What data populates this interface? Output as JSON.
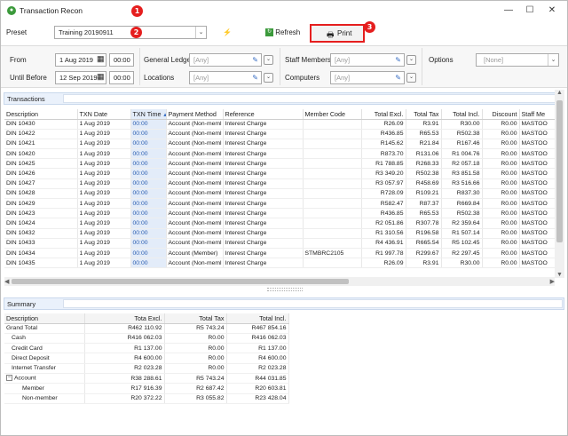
{
  "window": {
    "title": "Transaction Recon",
    "minimize": "—",
    "maximize": "☐",
    "close": "✕"
  },
  "badges": [
    "1",
    "2",
    "3"
  ],
  "toolbar": {
    "preset_label": "Preset",
    "preset_value": "Training 20190911",
    "refresh_label": "Refresh",
    "print_label": "Print"
  },
  "filters": {
    "from_label": "From",
    "from_date": "1 Aug 2019",
    "from_time": "00:00",
    "until_label": "Until Before",
    "until_date": "12 Sep 2019",
    "until_time": "00:00",
    "general_ledgers_label": "General Ledgers",
    "general_ledgers_value": "[Any]",
    "locations_label": "Locations",
    "locations_value": "[Any]",
    "staff_members_label": "Staff Members",
    "staff_members_value": "[Any]",
    "computers_label": "Computers",
    "computers_value": "[Any]",
    "options_label": "Options",
    "options_value": "[None]"
  },
  "transactions": {
    "section_label": "Transactions",
    "columns": [
      "Description",
      "TXN Date",
      "TXN Time",
      "Payment Method",
      "Reference",
      "Member Code",
      "Total Excl.",
      "Total Tax",
      "Total Incl.",
      "Discount",
      "Staff Me"
    ],
    "rows": [
      [
        "DIN 10430",
        "1 Aug 2019",
        "00:00",
        "Account (Non-meml",
        "Interest Charge",
        "",
        "R26.09",
        "R3.91",
        "R30.00",
        "R0.00",
        "MASTOO"
      ],
      [
        "DIN 10422",
        "1 Aug 2019",
        "00:00",
        "Account (Non-meml",
        "Interest Charge",
        "",
        "R436.85",
        "R65.53",
        "R502.38",
        "R0.00",
        "MASTOO"
      ],
      [
        "DIN 10421",
        "1 Aug 2019",
        "00:00",
        "Account (Non-meml",
        "Interest Charge",
        "",
        "R145.62",
        "R21.84",
        "R167.46",
        "R0.00",
        "MASTOO"
      ],
      [
        "DIN 10420",
        "1 Aug 2019",
        "00:00",
        "Account (Non-meml",
        "Interest Charge",
        "",
        "R873.70",
        "R131.06",
        "R1 004.76",
        "R0.00",
        "MASTOO"
      ],
      [
        "DIN 10425",
        "1 Aug 2019",
        "00:00",
        "Account (Non-meml",
        "Interest Charge",
        "",
        "R1 788.85",
        "R268.33",
        "R2 057.18",
        "R0.00",
        "MASTOO"
      ],
      [
        "DIN 10426",
        "1 Aug 2019",
        "00:00",
        "Account (Non-meml",
        "Interest Charge",
        "",
        "R3 349.20",
        "R502.38",
        "R3 851.58",
        "R0.00",
        "MASTOO"
      ],
      [
        "DIN 10427",
        "1 Aug 2019",
        "00:00",
        "Account (Non-meml",
        "Interest Charge",
        "",
        "R3 057.97",
        "R458.69",
        "R3 516.66",
        "R0.00",
        "MASTOO"
      ],
      [
        "DIN 10428",
        "1 Aug 2019",
        "00:00",
        "Account (Non-meml",
        "Interest Charge",
        "",
        "R728.09",
        "R109.21",
        "R837.30",
        "R0.00",
        "MASTOO"
      ],
      [
        "DIN 10429",
        "1 Aug 2019",
        "00:00",
        "Account (Non-meml",
        "Interest Charge",
        "",
        "R582.47",
        "R87.37",
        "R669.84",
        "R0.00",
        "MASTOO"
      ],
      [
        "DIN 10423",
        "1 Aug 2019",
        "00:00",
        "Account (Non-meml",
        "Interest Charge",
        "",
        "R436.85",
        "R65.53",
        "R502.38",
        "R0.00",
        "MASTOO"
      ],
      [
        "DIN 10424",
        "1 Aug 2019",
        "00:00",
        "Account (Non-meml",
        "Interest Charge",
        "",
        "R2 051.86",
        "R307.78",
        "R2 359.64",
        "R0.00",
        "MASTOO"
      ],
      [
        "DIN 10432",
        "1 Aug 2019",
        "00:00",
        "Account (Non-meml",
        "Interest Charge",
        "",
        "R1 310.56",
        "R196.58",
        "R1 507.14",
        "R0.00",
        "MASTOO"
      ],
      [
        "DIN 10433",
        "1 Aug 2019",
        "00:00",
        "Account (Non-meml",
        "Interest Charge",
        "",
        "R4 436.91",
        "R665.54",
        "R5 102.45",
        "R0.00",
        "MASTOO"
      ],
      [
        "DIN 10434",
        "1 Aug 2019",
        "00:00",
        "Account (Member)",
        "Interest Charge",
        "STMBRC2105",
        "R1 997.78",
        "R299.67",
        "R2 297.45",
        "R0.00",
        "MASTOO"
      ],
      [
        "DIN 10435",
        "1 Aug 2019",
        "00:00",
        "Account (Non-meml",
        "Interest Charge",
        "",
        "R26.09",
        "R3.91",
        "R30.00",
        "R0.00",
        "MASTOO"
      ]
    ]
  },
  "summary": {
    "section_label": "Summary",
    "columns": [
      "Description",
      "Tota Excl.",
      "Total Tax",
      "Total Incl."
    ],
    "rows": [
      {
        "desc": "Grand Total",
        "excl": "R462 110.92",
        "tax": "R5 743.24",
        "incl": "R467 854.16",
        "level": 0
      },
      {
        "desc": "Cash",
        "excl": "R416 062.03",
        "tax": "R0.00",
        "incl": "R416 062.03",
        "level": 1
      },
      {
        "desc": "Credit Card",
        "excl": "R1 137.00",
        "tax": "R0.00",
        "incl": "R1 137.00",
        "level": 1
      },
      {
        "desc": "Direct Deposit",
        "excl": "R4 600.00",
        "tax": "R0.00",
        "incl": "R4 600.00",
        "level": 1
      },
      {
        "desc": "Internet Transfer",
        "excl": "R2 023.28",
        "tax": "R0.00",
        "incl": "R2 023.28",
        "level": 1
      },
      {
        "desc": "Account",
        "excl": "R38 288.61",
        "tax": "R5 743.24",
        "incl": "R44 031.85",
        "level": 1,
        "expander": "−"
      },
      {
        "desc": "Member",
        "excl": "R17 916.39",
        "tax": "R2 687.42",
        "incl": "R20 603.81",
        "level": 2
      },
      {
        "desc": "Non-member",
        "excl": "R20 372.22",
        "tax": "R3 055.82",
        "incl": "R23 428.04",
        "level": 2
      }
    ]
  },
  "colors": {
    "highlight": "#e51e1e",
    "section_header": "#eaf1fb",
    "time_column": "#e3ecf9"
  }
}
